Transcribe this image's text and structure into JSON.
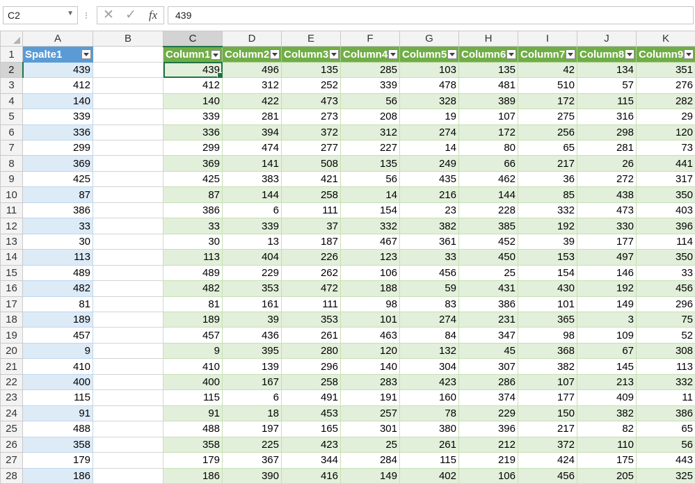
{
  "formula_bar": {
    "name_box": "C2",
    "cancel_icon": "✕",
    "enter_icon": "✓",
    "fx_label": "fx",
    "formula": "439"
  },
  "columns": [
    "A",
    "B",
    "C",
    "D",
    "E",
    "F",
    "G",
    "H",
    "I",
    "J",
    "K"
  ],
  "selected_column": "C",
  "selected_row": 2,
  "active_cell": "C2",
  "table_a": {
    "header": "Spalte1",
    "style_color": "#5b9bd5"
  },
  "table_main": {
    "headers": [
      "Column1",
      "Column2",
      "Column3",
      "Column4",
      "Column5",
      "Column6",
      "Column7",
      "Column8",
      "Column9"
    ],
    "style_color": "#70ad47"
  },
  "rows": [
    {
      "n": "2",
      "a": "439",
      "v": [
        "439",
        "496",
        "135",
        "285",
        "103",
        "135",
        "42",
        "134",
        "351"
      ]
    },
    {
      "n": "3",
      "a": "412",
      "v": [
        "412",
        "312",
        "252",
        "339",
        "478",
        "481",
        "510",
        "57",
        "276"
      ]
    },
    {
      "n": "4",
      "a": "140",
      "v": [
        "140",
        "422",
        "473",
        "56",
        "328",
        "389",
        "172",
        "115",
        "282"
      ]
    },
    {
      "n": "5",
      "a": "339",
      "v": [
        "339",
        "281",
        "273",
        "208",
        "19",
        "107",
        "275",
        "316",
        "29"
      ]
    },
    {
      "n": "6",
      "a": "336",
      "v": [
        "336",
        "394",
        "372",
        "312",
        "274",
        "172",
        "256",
        "298",
        "120"
      ]
    },
    {
      "n": "7",
      "a": "299",
      "v": [
        "299",
        "474",
        "277",
        "227",
        "14",
        "80",
        "65",
        "281",
        "73"
      ]
    },
    {
      "n": "8",
      "a": "369",
      "v": [
        "369",
        "141",
        "508",
        "135",
        "249",
        "66",
        "217",
        "26",
        "441"
      ]
    },
    {
      "n": "9",
      "a": "425",
      "v": [
        "425",
        "383",
        "421",
        "56",
        "435",
        "462",
        "36",
        "272",
        "317"
      ]
    },
    {
      "n": "10",
      "a": "87",
      "v": [
        "87",
        "144",
        "258",
        "14",
        "216",
        "144",
        "85",
        "438",
        "350"
      ]
    },
    {
      "n": "11",
      "a": "386",
      "v": [
        "386",
        "6",
        "111",
        "154",
        "23",
        "228",
        "332",
        "473",
        "403"
      ]
    },
    {
      "n": "12",
      "a": "33",
      "v": [
        "33",
        "339",
        "37",
        "332",
        "382",
        "385",
        "192",
        "330",
        "396"
      ]
    },
    {
      "n": "13",
      "a": "30",
      "v": [
        "30",
        "13",
        "187",
        "467",
        "361",
        "452",
        "39",
        "177",
        "114"
      ]
    },
    {
      "n": "14",
      "a": "113",
      "v": [
        "113",
        "404",
        "226",
        "123",
        "33",
        "450",
        "153",
        "497",
        "350"
      ]
    },
    {
      "n": "15",
      "a": "489",
      "v": [
        "489",
        "229",
        "262",
        "106",
        "456",
        "25",
        "154",
        "146",
        "33"
      ]
    },
    {
      "n": "16",
      "a": "482",
      "v": [
        "482",
        "353",
        "472",
        "188",
        "59",
        "431",
        "430",
        "192",
        "456"
      ]
    },
    {
      "n": "17",
      "a": "81",
      "v": [
        "81",
        "161",
        "111",
        "98",
        "83",
        "386",
        "101",
        "149",
        "296"
      ]
    },
    {
      "n": "18",
      "a": "189",
      "v": [
        "189",
        "39",
        "353",
        "101",
        "274",
        "231",
        "365",
        "3",
        "75"
      ]
    },
    {
      "n": "19",
      "a": "457",
      "v": [
        "457",
        "436",
        "261",
        "463",
        "84",
        "347",
        "98",
        "109",
        "52"
      ]
    },
    {
      "n": "20",
      "a": "9",
      "v": [
        "9",
        "395",
        "280",
        "120",
        "132",
        "45",
        "368",
        "67",
        "308"
      ]
    },
    {
      "n": "21",
      "a": "410",
      "v": [
        "410",
        "139",
        "296",
        "140",
        "304",
        "307",
        "382",
        "145",
        "113"
      ]
    },
    {
      "n": "22",
      "a": "400",
      "v": [
        "400",
        "167",
        "258",
        "283",
        "423",
        "286",
        "107",
        "213",
        "332"
      ]
    },
    {
      "n": "23",
      "a": "115",
      "v": [
        "115",
        "6",
        "491",
        "191",
        "160",
        "374",
        "177",
        "409",
        "11"
      ]
    },
    {
      "n": "24",
      "a": "91",
      "v": [
        "91",
        "18",
        "453",
        "257",
        "78",
        "229",
        "150",
        "382",
        "386"
      ]
    },
    {
      "n": "25",
      "a": "488",
      "v": [
        "488",
        "197",
        "165",
        "301",
        "380",
        "396",
        "217",
        "82",
        "65"
      ]
    },
    {
      "n": "26",
      "a": "358",
      "v": [
        "358",
        "225",
        "423",
        "25",
        "261",
        "212",
        "372",
        "110",
        "56"
      ]
    },
    {
      "n": "27",
      "a": "179",
      "v": [
        "179",
        "367",
        "344",
        "284",
        "115",
        "219",
        "424",
        "175",
        "443"
      ]
    },
    {
      "n": "28",
      "a": "186",
      "v": [
        "186",
        "390",
        "416",
        "149",
        "402",
        "106",
        "456",
        "205",
        "325"
      ]
    }
  ]
}
